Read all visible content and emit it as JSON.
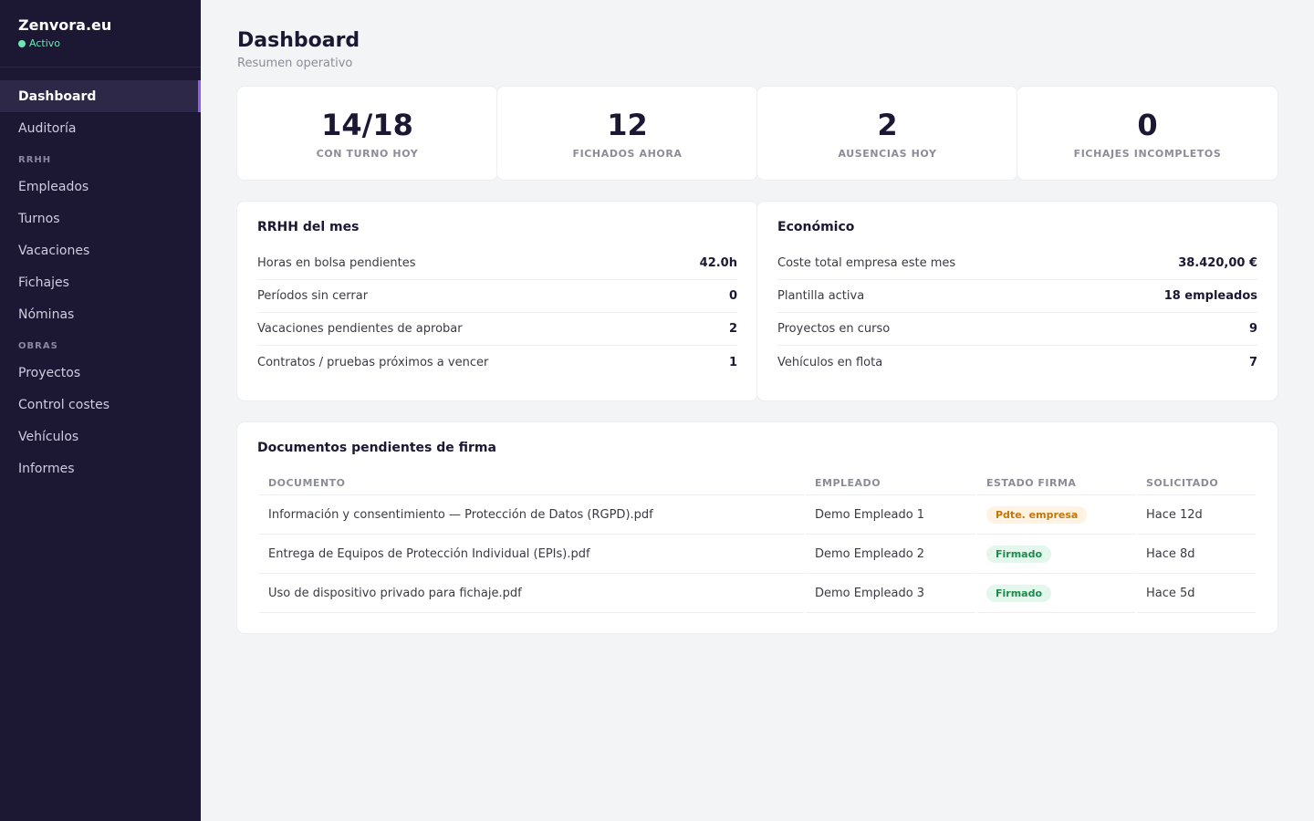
{
  "brand": {
    "name": "Zenvora.eu",
    "status": "Activo",
    "status_color": "#6ee7b7"
  },
  "nav": {
    "top": [
      {
        "label": "Dashboard",
        "active": true
      },
      {
        "label": "Auditoría"
      }
    ],
    "sections": [
      {
        "title": "RRHH",
        "items": [
          "Empleados",
          "Turnos",
          "Vacaciones",
          "Fichajes",
          "Nóminas"
        ]
      },
      {
        "title": "OBRAS",
        "items": [
          "Proyectos",
          "Control costes",
          "Vehículos",
          "Informes"
        ]
      }
    ]
  },
  "header": {
    "title": "Dashboard",
    "subtitle": "Resumen operativo"
  },
  "kpis": [
    {
      "value": "14/18",
      "label": "CON TURNO HOY"
    },
    {
      "value": "12",
      "label": "FICHADOS AHORA"
    },
    {
      "value": "2",
      "label": "AUSENCIAS HOY"
    },
    {
      "value": "0",
      "label": "FICHAJES INCOMPLETOS"
    }
  ],
  "panels": {
    "rrhh": {
      "title": "RRHH del mes",
      "rows": [
        {
          "label": "Horas en bolsa pendientes",
          "value": "42.0h"
        },
        {
          "label": "Períodos sin cerrar",
          "value": "0"
        },
        {
          "label": "Vacaciones pendientes de aprobar",
          "value": "2"
        },
        {
          "label": "Contratos / pruebas próximos a vencer",
          "value": "1"
        }
      ]
    },
    "economico": {
      "title": "Económico",
      "rows": [
        {
          "label": "Coste total empresa este mes",
          "value": "38.420,00 €"
        },
        {
          "label": "Plantilla activa",
          "value": "18 empleados"
        },
        {
          "label": "Proyectos en curso",
          "value": "9"
        },
        {
          "label": "Vehículos en flota",
          "value": "7"
        }
      ]
    }
  },
  "documents": {
    "title": "Documentos pendientes de firma",
    "columns": [
      "DOCUMENTO",
      "EMPLEADO",
      "ESTADO FIRMA",
      "SOLICITADO"
    ],
    "rows": [
      {
        "document": "Información y consentimiento — Protección de Datos (RGPD).pdf",
        "employee": "Demo Empleado 1",
        "status": "Pdte. empresa",
        "status_kind": "pending",
        "requested": "Hace 12d"
      },
      {
        "document": "Entrega de Equipos de Protección Individual (EPIs).pdf",
        "employee": "Demo Empleado 2",
        "status": "Firmado",
        "status_kind": "signed",
        "requested": "Hace 8d"
      },
      {
        "document": "Uso de dispositivo privado para fichaje.pdf",
        "employee": "Demo Empleado 3",
        "status": "Firmado",
        "status_kind": "signed",
        "requested": "Hace 5d"
      }
    ]
  },
  "colors": {
    "sidebar_bg": "#1c1733",
    "accent": "#8b5cf6",
    "page_bg": "#f3f4f6"
  }
}
